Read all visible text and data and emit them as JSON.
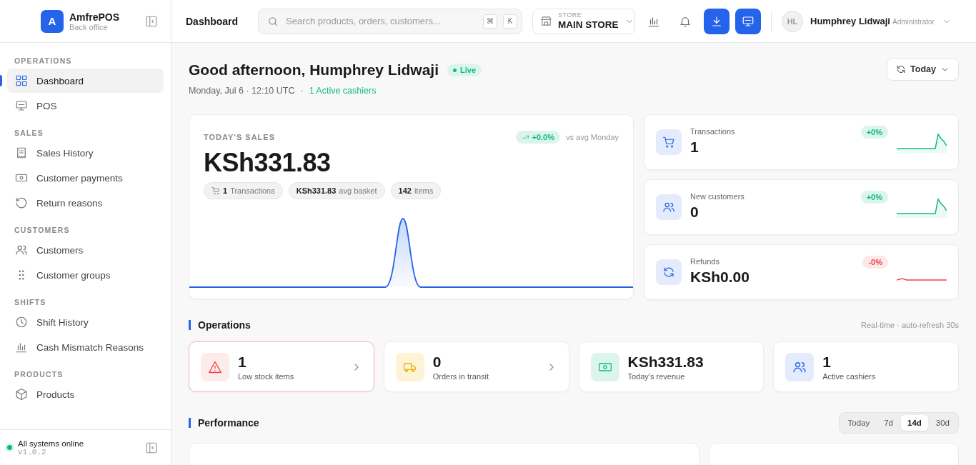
{
  "sidebar": {
    "brand": {
      "logo": "A",
      "name": "AmfrePOS",
      "subtitle": "Back office"
    },
    "sections": [
      {
        "title": "OPERATIONS",
        "items": [
          {
            "label": "Dashboard",
            "selected": true
          },
          {
            "label": "POS",
            "selected": false
          }
        ]
      },
      {
        "title": "SALES",
        "items": [
          {
            "label": "Sales History",
            "selected": false
          },
          {
            "label": "Customer payments",
            "selected": false
          },
          {
            "label": "Return reasons",
            "selected": false
          }
        ]
      },
      {
        "title": "CUSTOMERS",
        "items": [
          {
            "label": "Customers",
            "selected": false
          },
          {
            "label": "Customer groups",
            "selected": false
          }
        ]
      },
      {
        "title": "SHIFTS",
        "items": [
          {
            "label": "Shift History",
            "selected": false
          },
          {
            "label": "Cash Mismatch Reasons",
            "selected": false
          }
        ]
      },
      {
        "title": "PRODUCTS",
        "items": [
          {
            "label": "Products",
            "selected": false
          }
        ]
      }
    ],
    "footer": {
      "status": "All systems online",
      "version": "v1.0.2"
    }
  },
  "topbar": {
    "title": "Dashboard",
    "search": {
      "placeholder": "Search products, orders, customers...",
      "keys": [
        "⌘",
        "K"
      ]
    },
    "store": {
      "label": "STORE",
      "value": "MAIN STORE"
    },
    "user": {
      "initials": "HL",
      "name": "Humphrey Lidwaji",
      "role": "Administrator"
    }
  },
  "header": {
    "greeting": "Good afternoon, Humphrey Lidwaji",
    "badge": "Live",
    "date": "Monday, Jul 6 · 12:10 UTC",
    "separator": "·",
    "cashiers": "1 Active cashiers",
    "range": "Today"
  },
  "sales": {
    "label": "TODAY'S SALES",
    "change": "+0.0%",
    "comparison": "vs avg Monday",
    "value": "KSh331.83",
    "chips": [
      {
        "value": "1",
        "text": "Transactions"
      },
      {
        "value": "KSh331.83",
        "text": "avg basket"
      },
      {
        "value": "142",
        "text": "items"
      }
    ]
  },
  "stats": [
    {
      "label": "Transactions",
      "value": "1",
      "change": "+0%",
      "kind": "up"
    },
    {
      "label": "New customers",
      "value": "0",
      "change": "+0%",
      "kind": "up"
    },
    {
      "label": "Refunds",
      "value": "KSh0.00",
      "change": "-0%",
      "kind": "down"
    }
  ],
  "operations": {
    "title": "Operations",
    "note": "Real-time · auto-refresh 30s",
    "cards": [
      {
        "value": "1",
        "label": "Low stock items",
        "kind": "alert",
        "link": true
      },
      {
        "value": "0",
        "label": "Orders in transit",
        "kind": "transit",
        "link": true
      },
      {
        "value": "KSh331.83",
        "label": "Today's revenue",
        "kind": "revenue",
        "link": false
      },
      {
        "value": "1",
        "label": "Active cashiers",
        "kind": "cashiers",
        "link": false
      }
    ]
  },
  "performance": {
    "title": "Performance",
    "ranges": [
      {
        "label": "Today",
        "selected": false
      },
      {
        "label": "7d",
        "selected": false
      },
      {
        "label": "14d",
        "selected": true
      },
      {
        "label": "30d",
        "selected": false
      }
    ]
  }
}
